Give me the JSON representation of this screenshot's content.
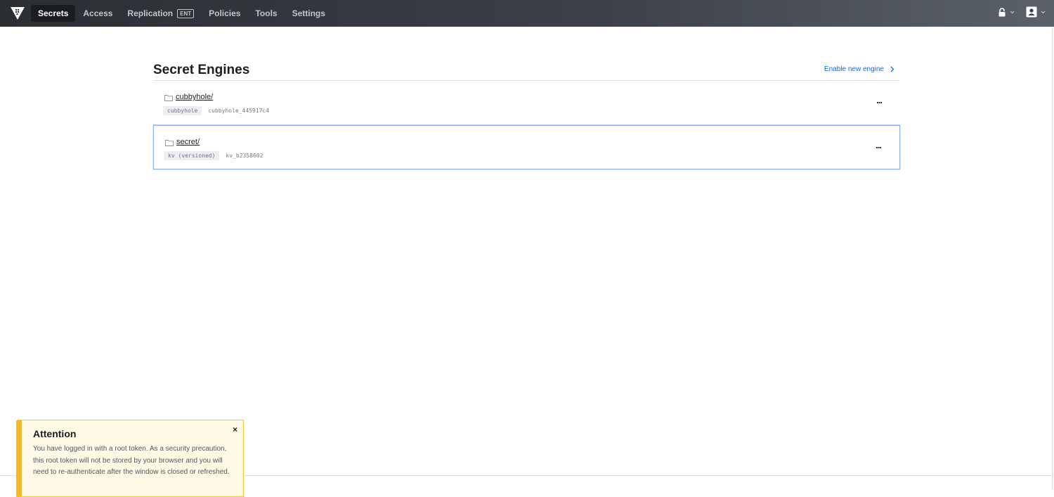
{
  "nav": {
    "items": [
      {
        "label": "Secrets",
        "active": true
      },
      {
        "label": "Access",
        "active": false
      },
      {
        "label": "Replication",
        "badge": "ENT",
        "active": false
      },
      {
        "label": "Policies",
        "active": false
      },
      {
        "label": "Tools",
        "active": false
      },
      {
        "label": "Settings",
        "active": false
      }
    ],
    "right_icons": [
      "lock-icon",
      "user-icon"
    ]
  },
  "page": {
    "title": "Secret Engines",
    "enable_link": "Enable new engine"
  },
  "engines": [
    {
      "path": "cubbyhole/",
      "type": "cubbyhole",
      "accessor": "cubbyhole_445917c4",
      "selected": false,
      "menu": "..."
    },
    {
      "path": "secret/",
      "type": "kv (versioned)",
      "accessor": "kv_b2358602",
      "selected": true,
      "menu": "..."
    }
  ],
  "flash": {
    "title": "Attention",
    "close": "×",
    "message": "You have logged in with a root token. As a security precaution, this root token will not be stored by your browser and you will need to re-authenticate after the window is closed or refreshed."
  },
  "colors": {
    "nav_bg": "#2b2e33",
    "link": "#1563ff",
    "selected_border": "#8ab1ff",
    "warning_border": "#f5b929",
    "warning_bg": "#fff9e6"
  }
}
